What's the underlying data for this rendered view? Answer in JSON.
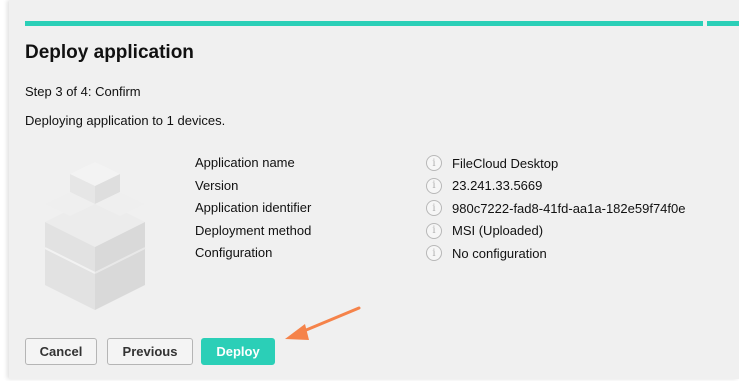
{
  "wizard": {
    "title": "Deploy application",
    "step": "Step 3 of 4: Confirm",
    "description": "Deploying application to 1 devices."
  },
  "details": [
    {
      "label": "Application name",
      "value": "FileCloud Desktop"
    },
    {
      "label": "Version",
      "value": "23.241.33.5669"
    },
    {
      "label": "Application identifier",
      "value": "980c7222-fad8-41fd-aa1a-182e59f74f0e"
    },
    {
      "label": "Deployment method",
      "value": "MSI (Uploaded)"
    },
    {
      "label": "Configuration",
      "value": "No configuration"
    }
  ],
  "buttons": {
    "cancel": "Cancel",
    "previous": "Previous",
    "deploy": "Deploy"
  },
  "icons": {
    "info": "i"
  },
  "colors": {
    "accent": "#2bcfb7",
    "annotation_arrow": "#f5834a"
  }
}
